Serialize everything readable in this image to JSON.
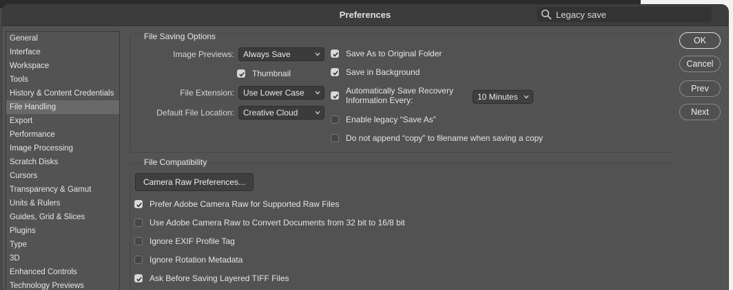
{
  "window": {
    "title": "Preferences",
    "search_value": "Legacy save"
  },
  "sidebar": {
    "items": [
      {
        "label": "General"
      },
      {
        "label": "Interface"
      },
      {
        "label": "Workspace"
      },
      {
        "label": "Tools"
      },
      {
        "label": "History & Content Credentials"
      },
      {
        "label": "File Handling",
        "selected": true
      },
      {
        "label": "Export"
      },
      {
        "label": "Performance"
      },
      {
        "label": "Image Processing"
      },
      {
        "label": "Scratch Disks"
      },
      {
        "label": "Cursors"
      },
      {
        "label": "Transparency & Gamut"
      },
      {
        "label": "Units & Rulers"
      },
      {
        "label": "Guides, Grid & Slices"
      },
      {
        "label": "Plugins"
      },
      {
        "label": "Type"
      },
      {
        "label": "3D"
      },
      {
        "label": "Enhanced Controls"
      },
      {
        "label": "Technology Previews"
      }
    ]
  },
  "file_saving": {
    "legend": "File Saving Options",
    "image_previews_label": "Image Previews:",
    "image_previews_value": "Always Save",
    "thumbnail_label": "Thumbnail",
    "thumbnail_checked": true,
    "file_extension_label": "File Extension:",
    "file_extension_value": "Use Lower Case",
    "default_location_label": "Default File Location:",
    "default_location_value": "Creative Cloud",
    "save_as_original_label": "Save As to Original Folder",
    "save_as_original_checked": true,
    "save_background_label": "Save in Background",
    "save_background_checked": true,
    "auto_save_label_line1": "Automatically Save Recovery",
    "auto_save_label_line2": "Information Every:",
    "auto_save_checked": true,
    "auto_save_interval": "10 Minutes",
    "legacy_save_as_label": "Enable legacy “Save As”",
    "legacy_save_as_checked": false,
    "no_append_copy_label": "Do not append “copy” to filename when saving a copy",
    "no_append_copy_checked": false
  },
  "file_compat": {
    "legend": "File Compatibility",
    "camera_raw_button": "Camera Raw Preferences...",
    "options": [
      {
        "label": "Prefer Adobe Camera Raw for Supported Raw Files",
        "checked": true
      },
      {
        "label": "Use Adobe Camera Raw to Convert Documents from 32 bit to 16/8 bit",
        "checked": false
      },
      {
        "label": "Ignore EXIF Profile Tag",
        "checked": false
      },
      {
        "label": "Ignore Rotation Metadata",
        "checked": false
      },
      {
        "label": "Ask Before Saving Layered TIFF Files",
        "checked": true
      }
    ]
  },
  "buttons": {
    "ok": "OK",
    "cancel": "Cancel",
    "prev": "Prev",
    "next": "Next"
  },
  "colors": {
    "window_bg": "#535353",
    "selected_item": "#696969",
    "checkbox_on": "#d9d9d9"
  }
}
